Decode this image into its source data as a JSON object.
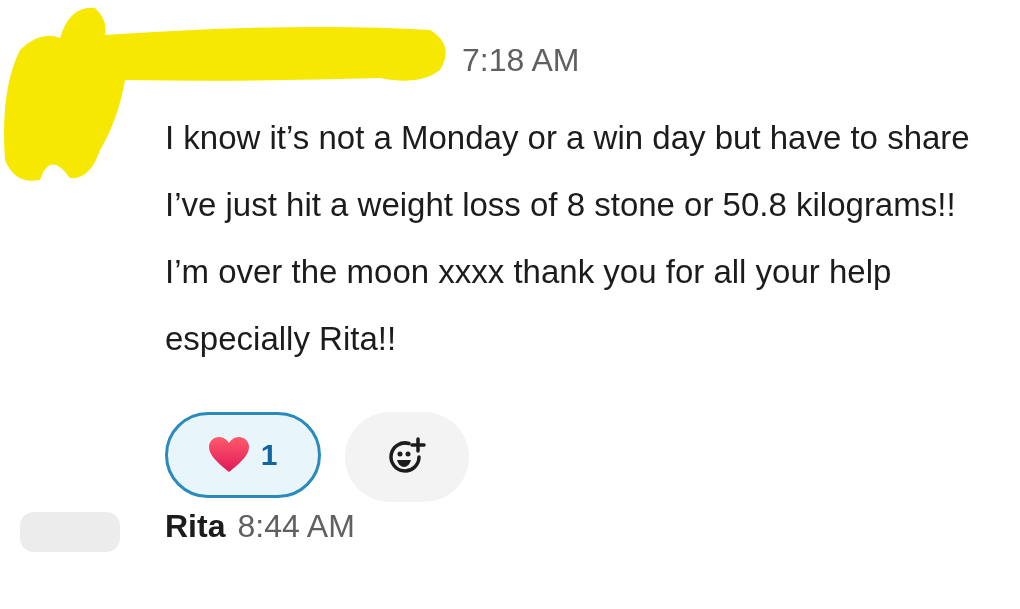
{
  "message": {
    "time": "7:18 AM",
    "text": "I know it’s not a Monday or a win day but have to share I’ve just hit a weight loss of 8 stone or 50.8 kilograms!! I’m over the moon xxxx thank you for all your help especially Rita!!",
    "reactions": [
      {
        "count": "1",
        "selected": true
      }
    ]
  },
  "next_message": {
    "author": "Rita",
    "time": "8:44 AM"
  }
}
